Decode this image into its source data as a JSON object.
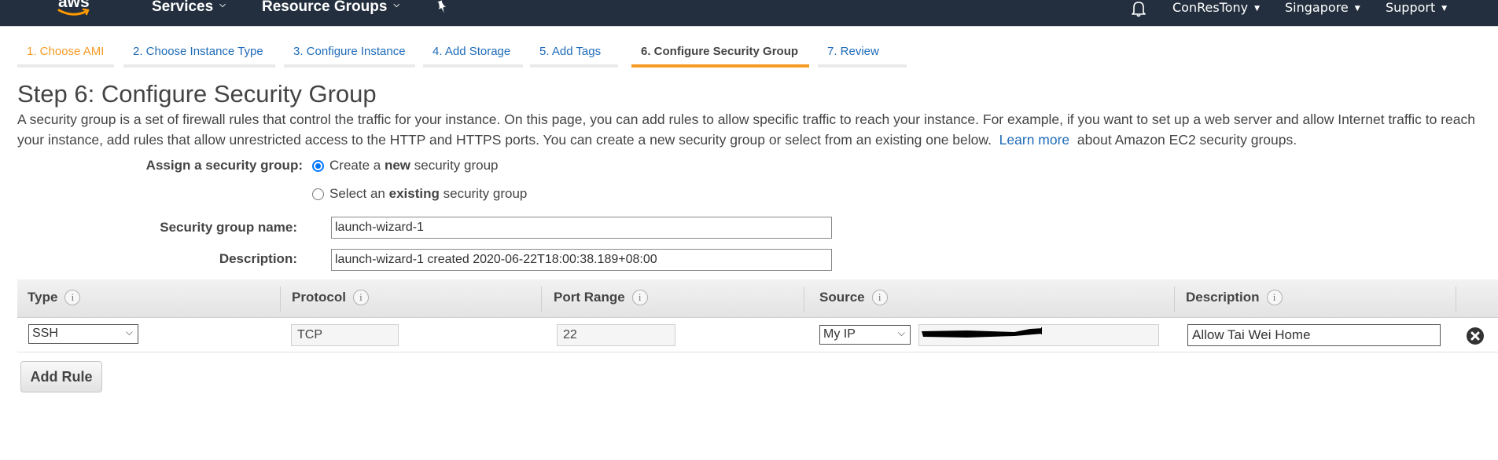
{
  "topbar": {
    "logo_text": "aws",
    "services_label": "Services",
    "resource_groups_label": "Resource Groups",
    "user_label": "ConResTony",
    "region_label": "Singapore",
    "support_label": "Support",
    "colors": {
      "background": "#232f3e",
      "accent": "#ff9900"
    }
  },
  "wizard": {
    "tabs": [
      {
        "label": "1. Choose AMI",
        "state": "done"
      },
      {
        "label": "2. Choose Instance Type",
        "state": "default"
      },
      {
        "label": "3. Configure Instance",
        "state": "default"
      },
      {
        "label": "4. Add Storage",
        "state": "default"
      },
      {
        "label": "5. Add Tags",
        "state": "default"
      },
      {
        "label": "6. Configure Security Group",
        "state": "active"
      },
      {
        "label": "7. Review",
        "state": "default"
      }
    ]
  },
  "page": {
    "title": "Step 6: Configure Security Group",
    "intro_text": "A security group is a set of firewall rules that control the traffic for your instance. On this page, you can add rules to allow specific traffic to reach your instance. For example, if you want to set up a web server and allow Internet traffic to reach your instance, add rules that allow unrestricted access to the HTTP and HTTPS ports. You can create a new security group or select from an existing one below.",
    "learn_more_label": "Learn more",
    "intro_suffix": "about Amazon EC2 security groups."
  },
  "form": {
    "assign_label": "Assign a security group:",
    "options": [
      {
        "prefix": "Create a ",
        "bold": "new",
        "suffix": " security group",
        "selected": true
      },
      {
        "prefix": "Select an ",
        "bold": "existing",
        "suffix": " security group",
        "selected": false
      }
    ],
    "name_label": "Security group name:",
    "name_value": "launch-wizard-1",
    "description_label": "Description:",
    "description_value": "launch-wizard-1 created 2020-06-22T18:00:38.189+08:00"
  },
  "rules_table": {
    "columns": [
      "Type",
      "Protocol",
      "Port Range",
      "Source",
      "Description"
    ],
    "rows": [
      {
        "type": "SSH",
        "protocol": "TCP",
        "port_range": "22",
        "source_type": "My IP",
        "source_value": "[redacted]",
        "description": "Allow Tai Wei Home"
      }
    ],
    "add_rule_label": "Add Rule"
  }
}
